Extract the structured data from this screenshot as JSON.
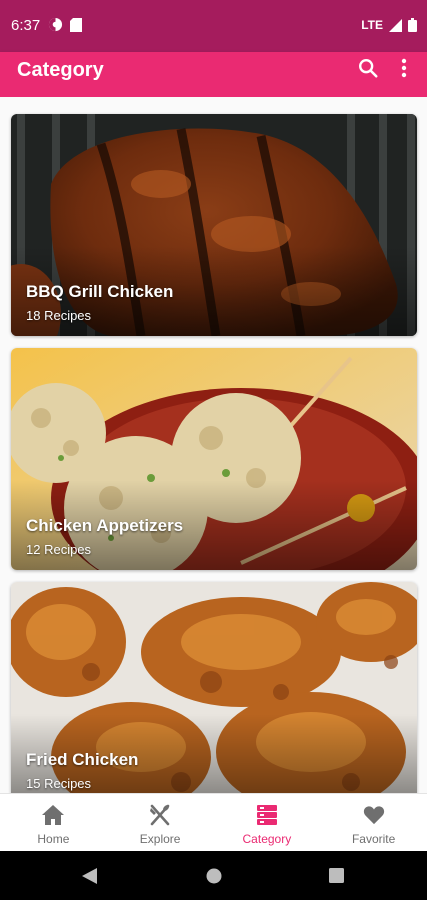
{
  "status_bar": {
    "time": "6:37",
    "network": "LTE"
  },
  "app_bar": {
    "title": "Category",
    "search_icon": "search-icon",
    "menu_icon": "more-vert-icon"
  },
  "categories": [
    {
      "title": "BBQ Grill Chicken",
      "count": "18 Recipes"
    },
    {
      "title": "Chicken Appetizers",
      "count": "12 Recipes"
    },
    {
      "title": "Fried Chicken",
      "count": "15 Recipes"
    }
  ],
  "bottom_nav": [
    {
      "label": "Home",
      "icon": "home-icon",
      "active": false
    },
    {
      "label": "Explore",
      "icon": "fork-knife-icon",
      "active": false
    },
    {
      "label": "Category",
      "icon": "category-icon",
      "active": true
    },
    {
      "label": "Favorite",
      "icon": "heart-icon",
      "active": false
    }
  ],
  "colors": {
    "primary": "#ea2a72",
    "status_bar": "#a51c5d",
    "inactive": "#6f6f6f"
  }
}
